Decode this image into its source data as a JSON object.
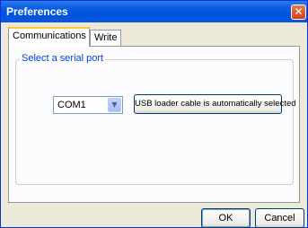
{
  "window": {
    "title": "Preferences",
    "close_glyph": "✕"
  },
  "tabs": [
    {
      "label": "Communications",
      "active": true
    },
    {
      "label": "Write",
      "active": false
    }
  ],
  "group": {
    "legend": "Select a serial port"
  },
  "port_select": {
    "value": "COM1",
    "arrow_glyph": "▼"
  },
  "usb_button": {
    "label": "USB loader cable is automatically selected"
  },
  "footer": {
    "ok_label": "OK",
    "cancel_label": "Cancel"
  },
  "colors": {
    "titlebar": "#0a5ce4",
    "legend_text": "#0046d5",
    "active_tab_accent": "#ffc83c"
  },
  "icons": {
    "close": "close-icon",
    "dropdown": "chevron-down-icon"
  }
}
